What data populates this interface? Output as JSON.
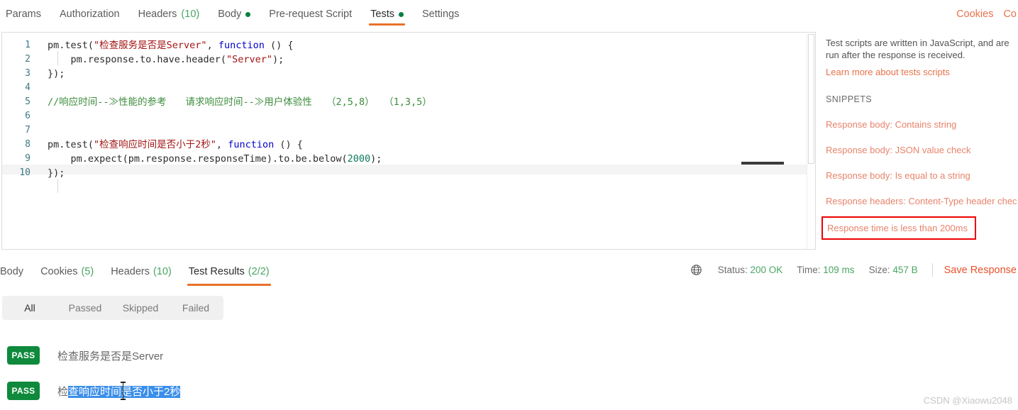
{
  "request_tabs": {
    "items": [
      {
        "label": "Params",
        "count": "",
        "dot": false
      },
      {
        "label": "Authorization",
        "count": "",
        "dot": false
      },
      {
        "label": "Headers",
        "count": "(10)",
        "dot": false
      },
      {
        "label": "Body",
        "count": "",
        "dot": true
      },
      {
        "label": "Pre-request Script",
        "count": "",
        "dot": false
      },
      {
        "label": "Tests",
        "count": "",
        "dot": true
      },
      {
        "label": "Settings",
        "count": "",
        "dot": false
      }
    ],
    "active_index": 5,
    "right_links": [
      "Cookies",
      "Co"
    ]
  },
  "editor": {
    "lines": [
      {
        "n": "1",
        "segments": [
          {
            "t": "pm.test(",
            "c": "plain"
          },
          {
            "t": "\"检查服务是否是Server\"",
            "c": "str"
          },
          {
            "t": ", ",
            "c": "plain"
          },
          {
            "t": "function",
            "c": "kw"
          },
          {
            "t": " () {",
            "c": "plain"
          }
        ]
      },
      {
        "n": "2",
        "segments": [
          {
            "t": "    pm.response.to.have.header(",
            "c": "plain"
          },
          {
            "t": "\"Server\"",
            "c": "str"
          },
          {
            "t": ");",
            "c": "plain"
          }
        ]
      },
      {
        "n": "3",
        "segments": [
          {
            "t": "});",
            "c": "plain"
          }
        ]
      },
      {
        "n": "4",
        "segments": [
          {
            "t": "",
            "c": "plain"
          }
        ]
      },
      {
        "n": "5",
        "segments": [
          {
            "t": "//响应时间--≫性能的参考　　请求响应时间--≫用户体验性　　（2,5,8）　　（1,3,5）",
            "c": "com"
          }
        ]
      },
      {
        "n": "6",
        "segments": [
          {
            "t": "",
            "c": "plain"
          }
        ]
      },
      {
        "n": "7",
        "segments": [
          {
            "t": "",
            "c": "plain"
          }
        ]
      },
      {
        "n": "8",
        "segments": [
          {
            "t": "pm.test(",
            "c": "plain"
          },
          {
            "t": "\"检查响应时间是否小于2秒\"",
            "c": "str"
          },
          {
            "t": ", ",
            "c": "plain"
          },
          {
            "t": "function",
            "c": "kw"
          },
          {
            "t": " () {",
            "c": "plain"
          }
        ]
      },
      {
        "n": "9",
        "segments": [
          {
            "t": "    pm.expect(pm.response.responseTime).to.be.below(",
            "c": "plain"
          },
          {
            "t": "2000",
            "c": "num"
          },
          {
            "t": ");",
            "c": "plain"
          }
        ]
      },
      {
        "n": "10",
        "segments": [
          {
            "t": "});",
            "c": "plain"
          }
        ]
      }
    ]
  },
  "snippets": {
    "description": "Test scripts are written in JavaScript, and are run after the response is received.",
    "learn_more": "Learn more about tests scripts",
    "heading": "SNIPPETS",
    "items": [
      {
        "label": "Response body: Contains string",
        "highlighted": false
      },
      {
        "label": "Response body: JSON value check",
        "highlighted": false
      },
      {
        "label": "Response body: Is equal to a string",
        "highlighted": false
      },
      {
        "label": "Response headers: Content-Type header chec",
        "highlighted": false
      },
      {
        "label": "Response time is less than 200ms",
        "highlighted": true
      }
    ],
    "highlight_color": "#ee0000"
  },
  "response_tabs": {
    "items": [
      {
        "label": "Body",
        "count": ""
      },
      {
        "label": "Cookies",
        "count": "(5)"
      },
      {
        "label": "Headers",
        "count": "(10)"
      },
      {
        "label": "Test Results",
        "count": "(2/2)"
      }
    ],
    "active_index": 3
  },
  "response_meta": {
    "globe_icon": "globe-icon",
    "status_label": "Status:",
    "status_value": "200 OK",
    "time_label": "Time:",
    "time_value": "109 ms",
    "size_label": "Size:",
    "size_value": "457 B",
    "save_response": "Save Response"
  },
  "result_filters": {
    "items": [
      "All",
      "Passed",
      "Skipped",
      "Failed"
    ],
    "active_index": 0
  },
  "test_results": [
    {
      "status": "PASS",
      "name_prefix": "检",
      "name_selected": "查响应时间是否小于2秒",
      "name": "检查服务是否是Server",
      "selected": false
    },
    {
      "status": "PASS",
      "name_prefix": "检",
      "name_selected": "查响应时间是否小于2秒",
      "name": "检查响应时间是否小于2秒",
      "selected": true
    }
  ],
  "watermark": "CSDN @Xiaowu2048"
}
